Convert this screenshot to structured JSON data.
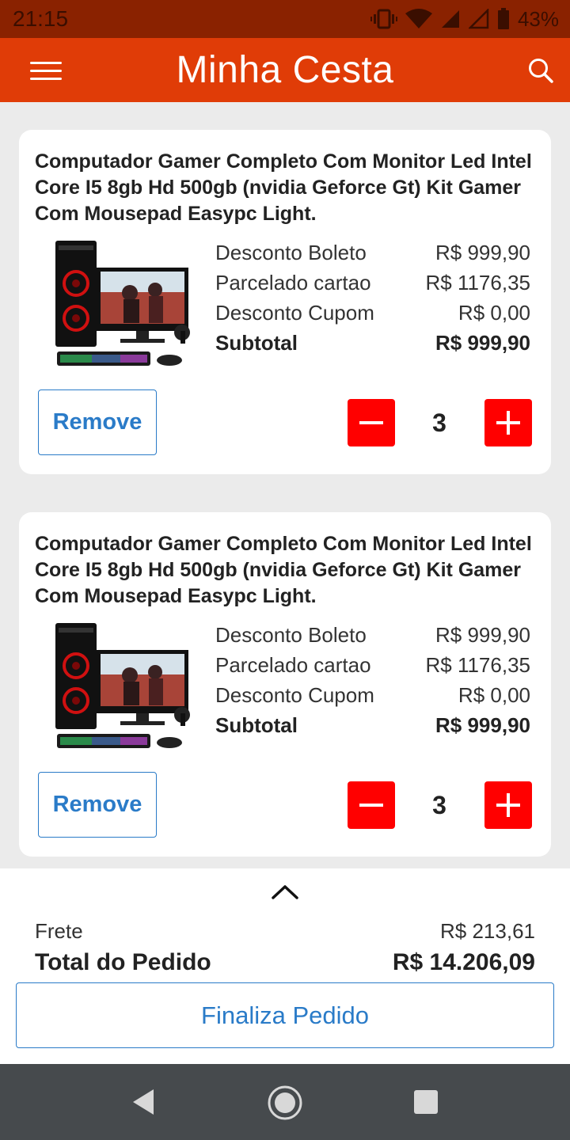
{
  "status_bar": {
    "time": "21:15",
    "battery": "43%"
  },
  "app_bar": {
    "title": "Minha Cesta",
    "menu_icon": "hamburger-menu-icon",
    "search_icon": "search-icon"
  },
  "colors": {
    "header": "#e03c07",
    "status_bar": "#8a2200",
    "qty_button": "#ff0000",
    "link_blue": "#2a7bc8"
  },
  "cart": {
    "items": [
      {
        "name": "Computador Gamer Completo Com Monitor Led Intel Core I5 8gb Hd 500gb (nvidia Geforce Gt) Kit Gamer Com Mousepad Easypc Light.",
        "prices": [
          {
            "label": "Desconto Boleto",
            "value": "R$ 999,90"
          },
          {
            "label": "Parcelado cartao",
            "value": "R$ 1176,35"
          },
          {
            "label": "Desconto Cupom",
            "value": "R$ 0,00"
          }
        ],
        "subtotal_label": "Subtotal",
        "subtotal_value": "R$ 999,90",
        "remove_label": "Remove",
        "quantity": "3"
      },
      {
        "name": "Computador Gamer Completo Com Monitor Led Intel Core I5 8gb Hd 500gb (nvidia Geforce Gt) Kit Gamer Com Mousepad Easypc Light.",
        "prices": [
          {
            "label": "Desconto Boleto",
            "value": "R$ 999,90"
          },
          {
            "label": "Parcelado cartao",
            "value": "R$ 1176,35"
          },
          {
            "label": "Desconto Cupom",
            "value": "R$ 0,00"
          }
        ],
        "subtotal_label": "Subtotal",
        "subtotal_value": "R$ 999,90",
        "remove_label": "Remove",
        "quantity": "3"
      }
    ]
  },
  "summary": {
    "frete_label": "Frete",
    "frete_value": "R$ 213,61",
    "total_label": "Total do Pedido",
    "total_value": "R$ 14.206,09",
    "finalize_label": "Finaliza Pedido"
  }
}
